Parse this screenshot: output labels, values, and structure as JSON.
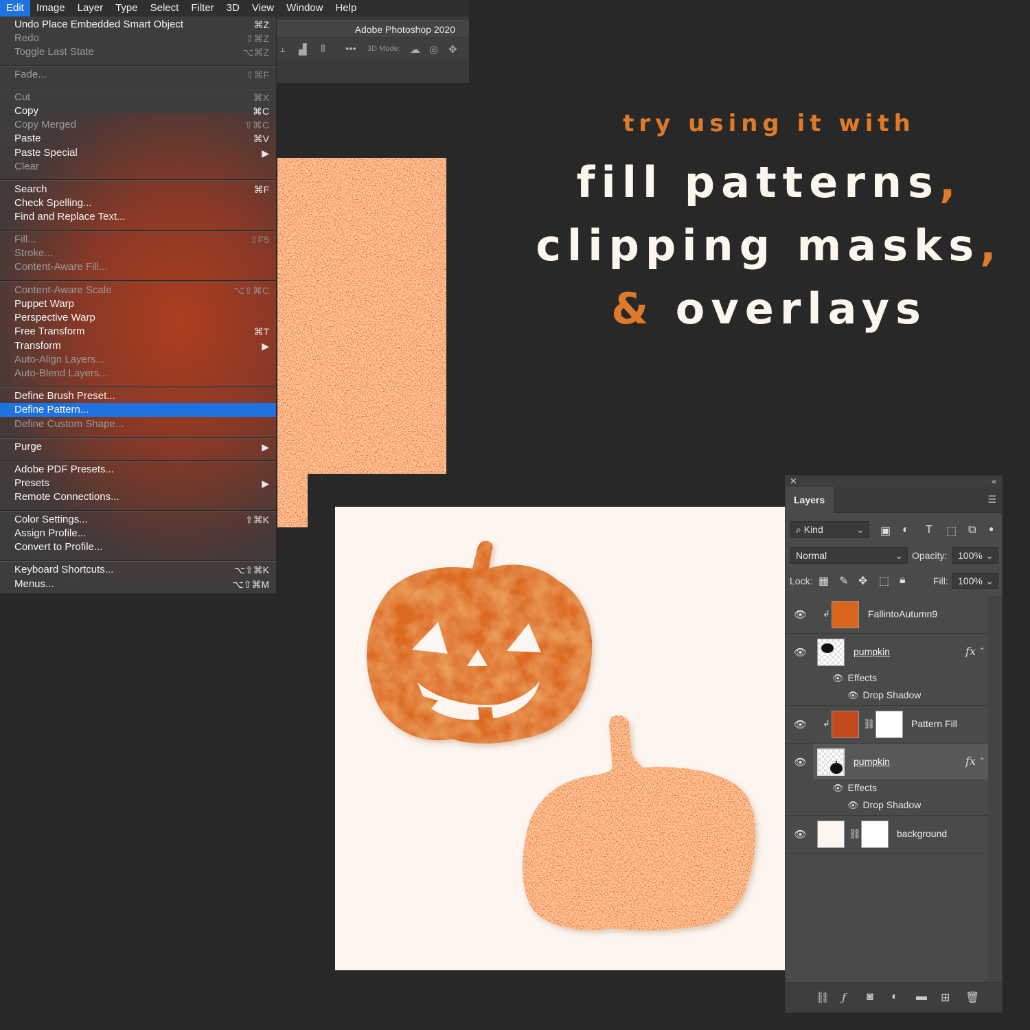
{
  "menubar": {
    "items": [
      "Edit",
      "Image",
      "Layer",
      "Type",
      "Select",
      "Filter",
      "3D",
      "View",
      "Window",
      "Help"
    ],
    "active": "Edit"
  },
  "app": {
    "title": "Adobe Photoshop 2020",
    "options_3d_label": "3D Mode:"
  },
  "edit_menu": {
    "items": [
      {
        "label": "Undo Place Embedded Smart Object",
        "shortcut": "⌘Z",
        "enabled": true
      },
      {
        "label": "Redo",
        "shortcut": "⇧⌘Z",
        "enabled": false
      },
      {
        "label": "Toggle Last State",
        "shortcut": "⌥⌘Z",
        "enabled": false
      },
      {
        "label": "Fade...",
        "shortcut": "⇧⌘F",
        "enabled": false
      },
      {
        "label": "Cut",
        "shortcut": "⌘X",
        "enabled": false
      },
      {
        "label": "Copy",
        "shortcut": "⌘C",
        "enabled": true
      },
      {
        "label": "Copy Merged",
        "shortcut": "⇧⌘C",
        "enabled": false
      },
      {
        "label": "Paste",
        "shortcut": "⌘V",
        "enabled": true
      },
      {
        "label": "Paste Special",
        "shortcut": "▶",
        "enabled": true
      },
      {
        "label": "Clear",
        "shortcut": "",
        "enabled": false
      },
      {
        "label": "Search",
        "shortcut": "⌘F",
        "enabled": true
      },
      {
        "label": "Check Spelling...",
        "shortcut": "",
        "enabled": true
      },
      {
        "label": "Find and Replace Text...",
        "shortcut": "",
        "enabled": true
      },
      {
        "label": "Fill...",
        "shortcut": "⇧F5",
        "enabled": false
      },
      {
        "label": "Stroke...",
        "shortcut": "",
        "enabled": false
      },
      {
        "label": "Content-Aware Fill...",
        "shortcut": "",
        "enabled": false
      },
      {
        "label": "Content-Aware Scale",
        "shortcut": "⌥⇧⌘C",
        "enabled": false
      },
      {
        "label": "Puppet Warp",
        "shortcut": "",
        "enabled": true
      },
      {
        "label": "Perspective Warp",
        "shortcut": "",
        "enabled": true
      },
      {
        "label": "Free Transform",
        "shortcut": "⌘T",
        "enabled": true
      },
      {
        "label": "Transform",
        "shortcut": "▶",
        "enabled": true
      },
      {
        "label": "Auto-Align Layers...",
        "shortcut": "",
        "enabled": false
      },
      {
        "label": "Auto-Blend Layers...",
        "shortcut": "",
        "enabled": false
      },
      {
        "label": "Define Brush Preset...",
        "shortcut": "",
        "enabled": true
      },
      {
        "label": "Define Pattern...",
        "shortcut": "",
        "enabled": true,
        "highlighted": true
      },
      {
        "label": "Define Custom Shape...",
        "shortcut": "",
        "enabled": false
      },
      {
        "label": "Purge",
        "shortcut": "▶",
        "enabled": true
      },
      {
        "label": "Adobe PDF Presets...",
        "shortcut": "",
        "enabled": true
      },
      {
        "label": "Presets",
        "shortcut": "▶",
        "enabled": true
      },
      {
        "label": "Remote Connections...",
        "shortcut": "",
        "enabled": true
      },
      {
        "label": "Color Settings...",
        "shortcut": "⇧⌘K",
        "enabled": true
      },
      {
        "label": "Assign Profile...",
        "shortcut": "",
        "enabled": true
      },
      {
        "label": "Convert to Profile...",
        "shortcut": "",
        "enabled": true
      },
      {
        "label": "Keyboard Shortcuts...",
        "shortcut": "⌥⇧⌘K",
        "enabled": true
      },
      {
        "label": "Menus...",
        "shortcut": "⌥⇧⌘M",
        "enabled": true
      }
    ]
  },
  "headline": {
    "line_try": "try using it with",
    "line1_main": "fill patterns",
    "line1_punct": ",",
    "line2_main": "clipping masks",
    "line2_punct": ",",
    "line3_amp": "&",
    "line3_main": "overlays"
  },
  "layers_panel": {
    "tab": "Layers",
    "filter_kind": "Kind",
    "blend_mode": "Normal",
    "opacity_label": "Opacity:",
    "opacity_value": "100%",
    "lock_label": "Lock:",
    "fill_label": "Fill:",
    "fill_value": "100%",
    "effects_label": "Effects",
    "drop_shadow_label": "Drop Shadow",
    "fx_label": "fx",
    "layers": [
      "FallintoAutumn9",
      "pumpkin",
      "Pattern Fill",
      "pumpkin",
      "background"
    ]
  },
  "colors": {
    "accent_orange": "#df7a2b",
    "menu_highlight": "#1e73e0",
    "pumpkin_orange": "#dd6b22",
    "glitter": "#c5461c",
    "canvas": "#fdf6f0"
  }
}
